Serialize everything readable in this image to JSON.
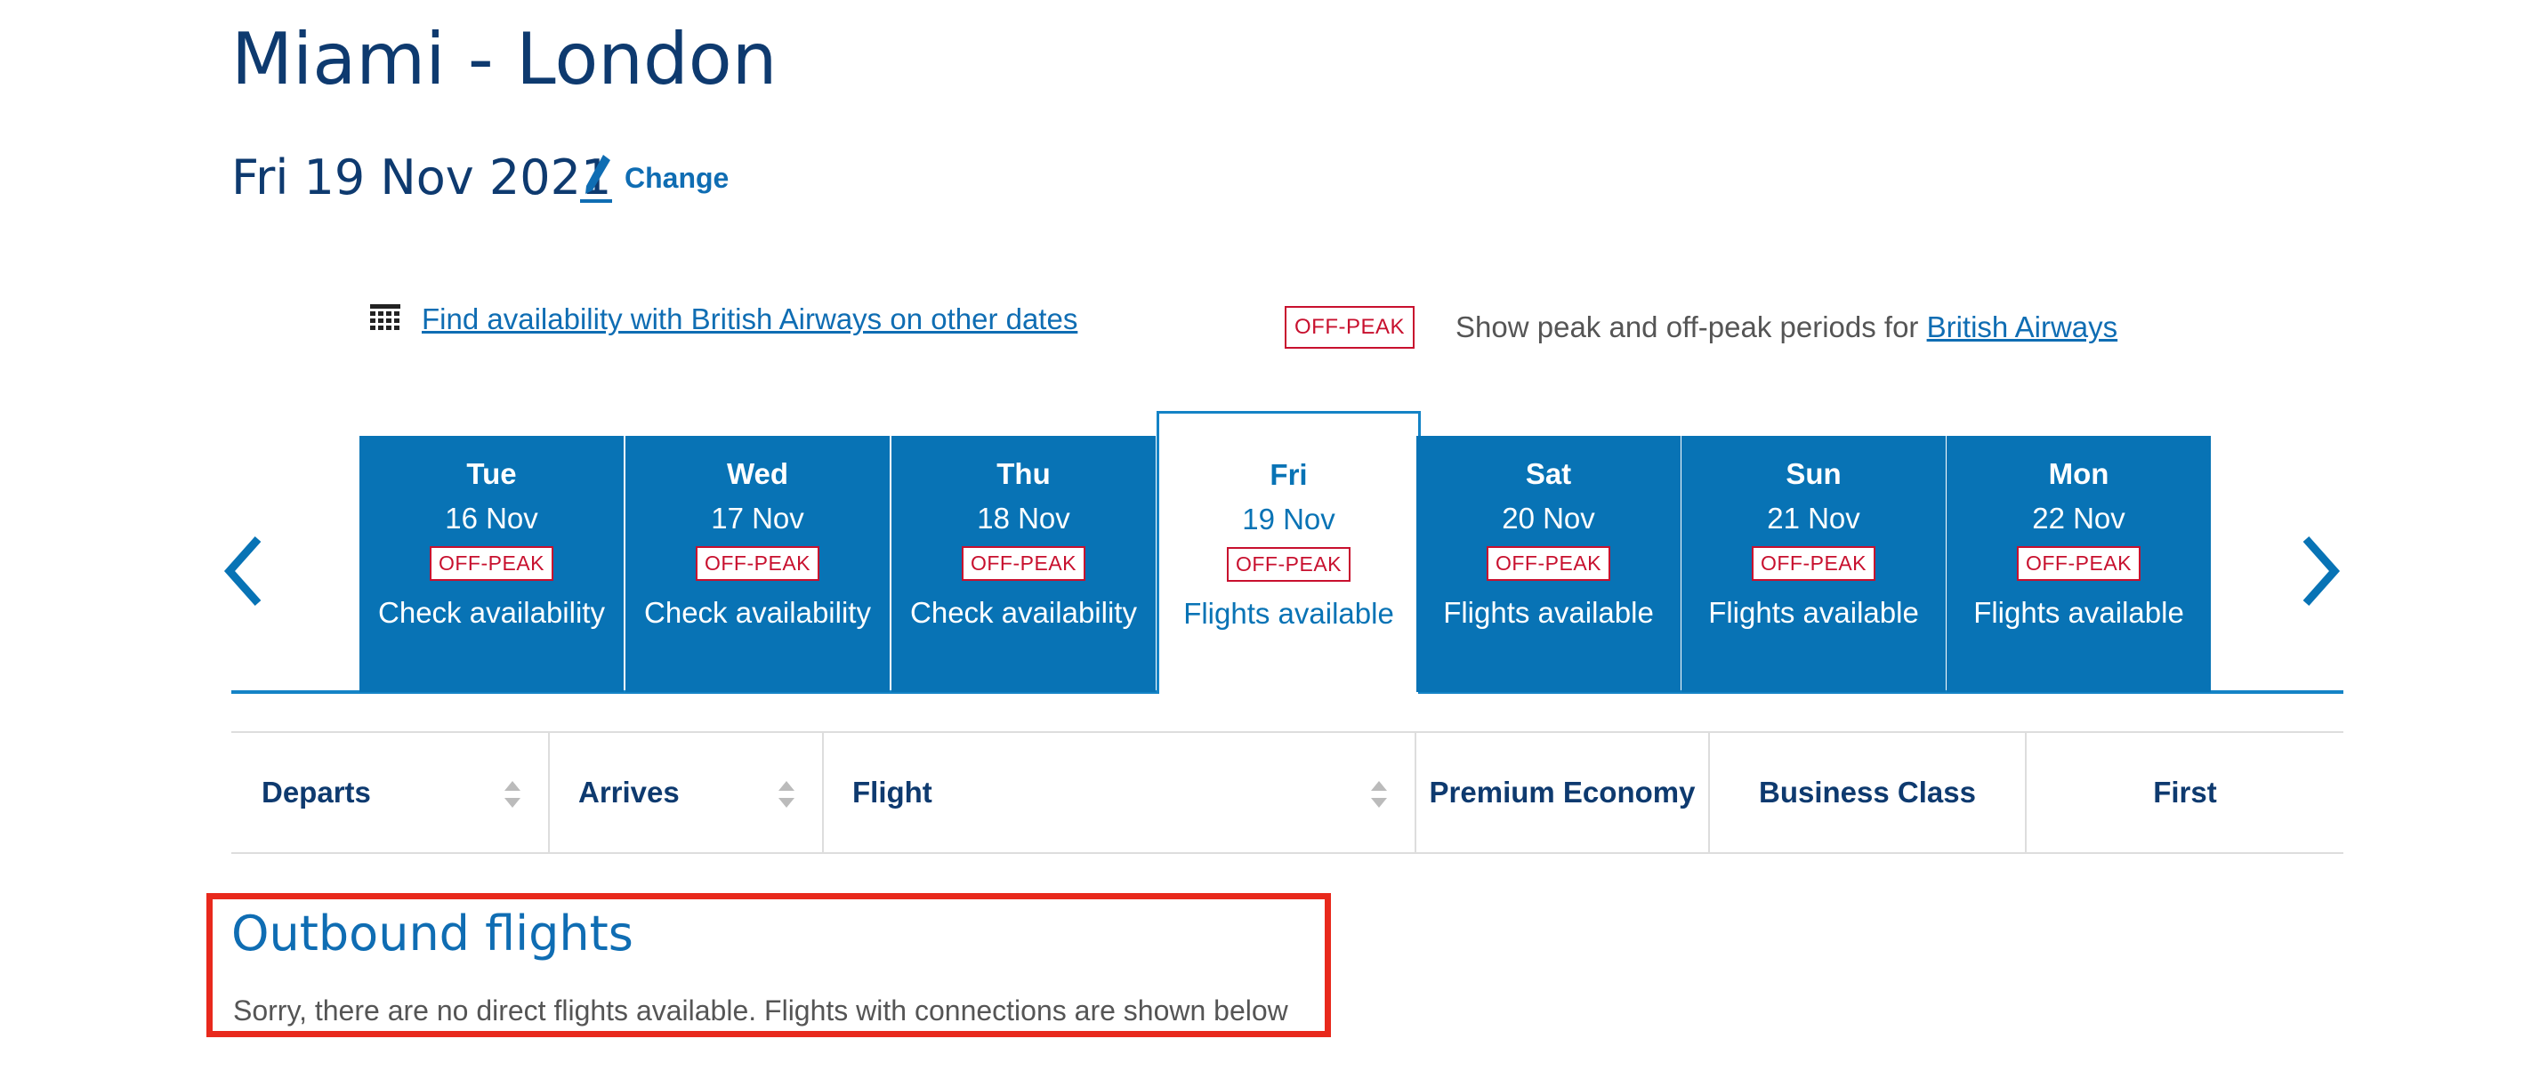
{
  "header": {
    "title": "Miami - London",
    "date": "Fri 19 Nov 2021",
    "change_label": "Change"
  },
  "availability": {
    "calendar_link": "Find availability with British Airways on other dates",
    "offpeak_badge": "OFF-PEAK",
    "peak_text": "Show peak and off-peak periods for ",
    "peak_link": "British Airways"
  },
  "days": [
    {
      "dow": "Tue",
      "date": "16 Nov",
      "badge": "OFF-PEAK",
      "status": "Check availability"
    },
    {
      "dow": "Wed",
      "date": "17 Nov",
      "badge": "OFF-PEAK",
      "status": "Check availability"
    },
    {
      "dow": "Thu",
      "date": "18 Nov",
      "badge": "OFF-PEAK",
      "status": "Check availability"
    },
    {
      "dow": "Fri",
      "date": "19 Nov",
      "badge": "OFF-PEAK",
      "status": "Flights available"
    },
    {
      "dow": "Sat",
      "date": "20 Nov",
      "badge": "OFF-PEAK",
      "status": "Flights available"
    },
    {
      "dow": "Sun",
      "date": "21 Nov",
      "badge": "OFF-PEAK",
      "status": "Flights available"
    },
    {
      "dow": "Mon",
      "date": "22 Nov",
      "badge": "OFF-PEAK",
      "status": "Flights available"
    }
  ],
  "table": {
    "columns": [
      "Departs",
      "Arrives",
      "Flight",
      "Premium Economy",
      "Business Class",
      "First"
    ]
  },
  "outbound": {
    "title": "Outbound flights",
    "message": "Sorry, there are no direct flights available. Flights with connections are shown below"
  },
  "colors": {
    "brand_blue": "#0873b5",
    "navy": "#0e3a6f",
    "link": "#0f6db3",
    "offpeak_red": "#c8102e",
    "highlight_red": "#e8291c"
  },
  "icons": [
    "pencil-icon",
    "calendar-grid-icon",
    "chevron-left-icon",
    "chevron-right-icon",
    "sort-icon"
  ]
}
